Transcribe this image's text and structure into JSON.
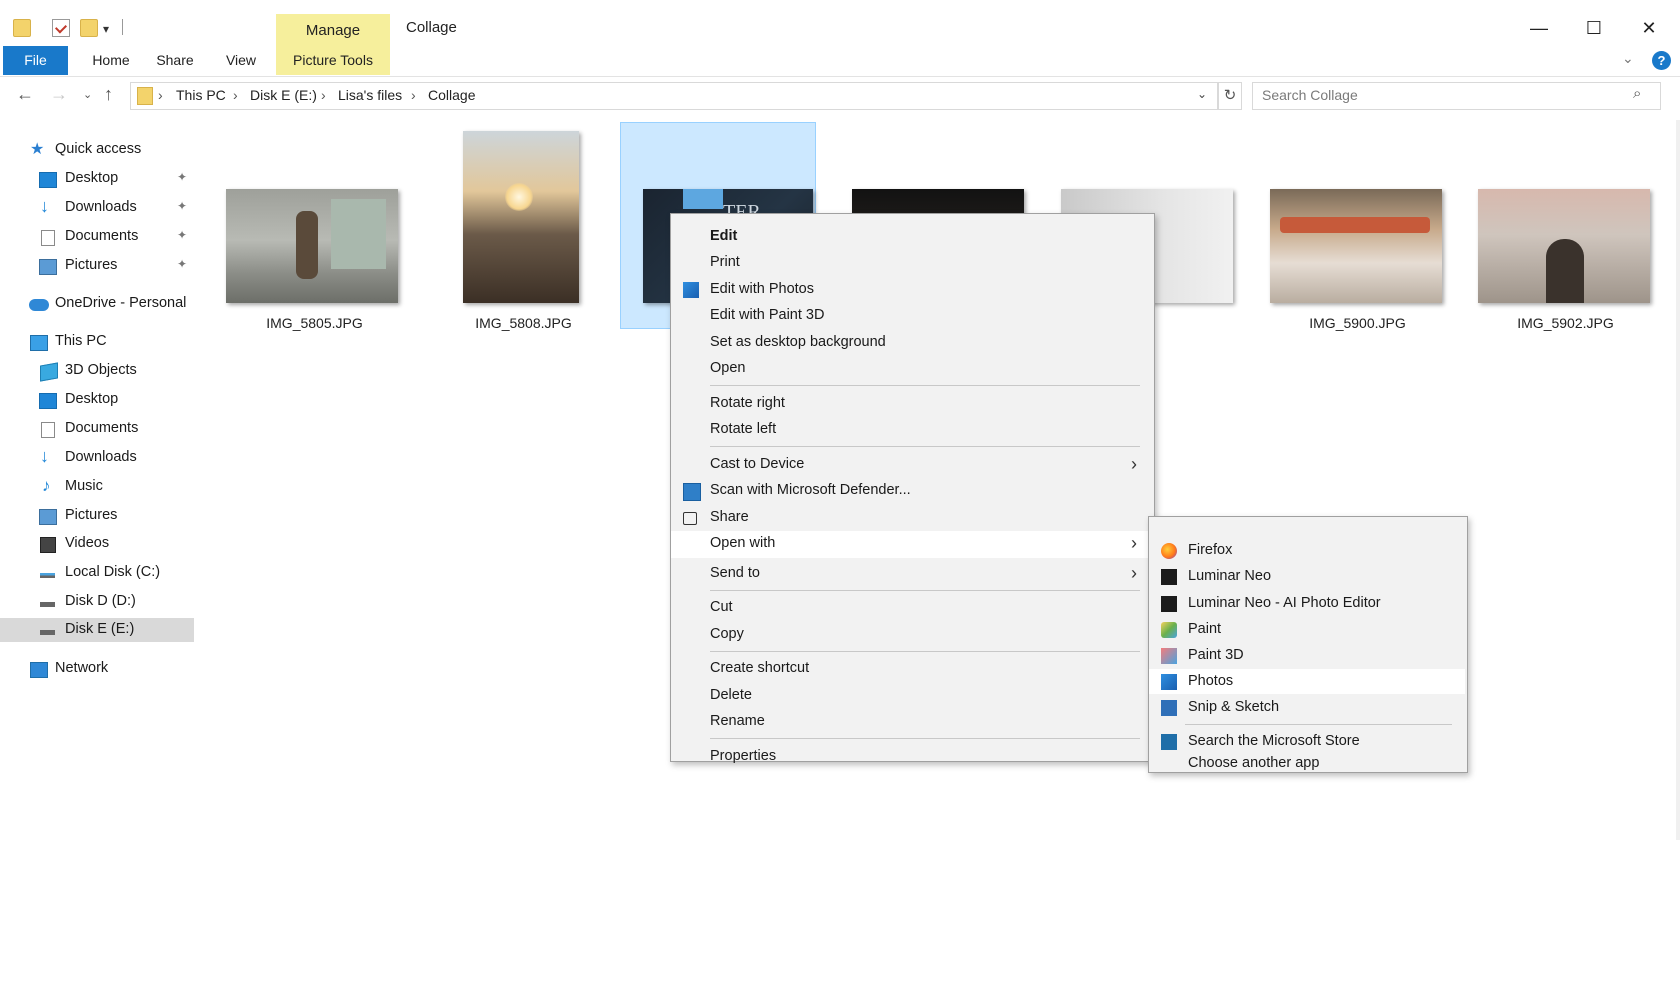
{
  "window": {
    "title": "Collage",
    "manage_label": "Manage",
    "qa_dropdown": "▾",
    "minimize": "—",
    "maximize": "☐",
    "close": "✕"
  },
  "ribbon": {
    "tabs": [
      "File",
      "Home",
      "Share",
      "View",
      "Picture Tools"
    ],
    "expand": "⌄",
    "help": "?"
  },
  "address": {
    "back": "←",
    "forward": "→",
    "recent": "⌄",
    "up": "↑",
    "breadcrumb": [
      "This PC",
      "Disk E (E:)",
      "Lisa's files",
      "Collage"
    ],
    "separator": "›",
    "dropdown": "⌄",
    "refresh": "↻",
    "search_placeholder": "Search Collage",
    "search_icon": "⌕"
  },
  "nav": {
    "pin_glyph": "✦",
    "items": [
      {
        "label": "Quick access",
        "icon": "star-icon"
      },
      {
        "label": "Desktop",
        "icon": "desktop-icon",
        "pinned": true
      },
      {
        "label": "Downloads",
        "icon": "download-icon",
        "pinned": true
      },
      {
        "label": "Documents",
        "icon": "documents-icon",
        "pinned": true
      },
      {
        "label": "Pictures",
        "icon": "pictures-icon",
        "pinned": true
      },
      {
        "label": "OneDrive - Personal",
        "icon": "cloud-icon"
      },
      {
        "label": "This PC",
        "icon": "pc-icon"
      },
      {
        "label": "3D Objects",
        "icon": "3d-objects-icon"
      },
      {
        "label": "Desktop",
        "icon": "desktop-icon"
      },
      {
        "label": "Documents",
        "icon": "documents-icon"
      },
      {
        "label": "Downloads",
        "icon": "download-icon"
      },
      {
        "label": "Music",
        "icon": "music-icon"
      },
      {
        "label": "Pictures",
        "icon": "pictures-icon"
      },
      {
        "label": "Videos",
        "icon": "videos-icon"
      },
      {
        "label": "Local Disk (C:)",
        "icon": "disk-icon"
      },
      {
        "label": "Disk D (D:)",
        "icon": "disk-icon"
      },
      {
        "label": "Disk E (E:)",
        "icon": "disk-icon",
        "selected": true
      },
      {
        "label": "Network",
        "icon": "network-icon"
      }
    ]
  },
  "files": [
    {
      "name": "IMG_5805.JPG"
    },
    {
      "name": "IMG_5808.JPG"
    },
    {
      "name": "",
      "selected": true,
      "overlay_text": "TER"
    },
    {
      "name": ""
    },
    {
      "name": "PG"
    },
    {
      "name": "IMG_5900.JPG"
    },
    {
      "name": "IMG_5902.JPG"
    }
  ],
  "context_menu": {
    "submenu_arrow": "›",
    "items": [
      {
        "label": "Edit",
        "bold": true
      },
      {
        "label": "Print"
      },
      {
        "label": "Edit with Photos",
        "icon": "photos-icon"
      },
      {
        "label": "Edit with Paint 3D"
      },
      {
        "label": "Set as desktop background"
      },
      {
        "label": "Open"
      },
      {
        "label": "Rotate right"
      },
      {
        "label": "Rotate left"
      },
      {
        "label": "Cast to Device",
        "submenu": true
      },
      {
        "label": "Scan with Microsoft Defender...",
        "icon": "defender-icon"
      },
      {
        "label": "Share",
        "icon": "share-icon"
      },
      {
        "label": "Open with",
        "submenu": true,
        "hover": true
      },
      {
        "label": "Send to",
        "submenu": true
      },
      {
        "label": "Cut"
      },
      {
        "label": "Copy"
      },
      {
        "label": "Create shortcut"
      },
      {
        "label": "Delete"
      },
      {
        "label": "Rename"
      },
      {
        "label": "Properties"
      }
    ]
  },
  "open_with": {
    "items": [
      {
        "label": "Firefox",
        "icon": "firefox-icon"
      },
      {
        "label": "Luminar Neo",
        "icon": "luminar-neo-icon"
      },
      {
        "label": "Luminar Neo - AI Photo Editor",
        "icon": "luminar-neo-ai-icon"
      },
      {
        "label": "Paint",
        "icon": "paint-icon"
      },
      {
        "label": "Paint 3D",
        "icon": "paint-3d-icon"
      },
      {
        "label": "Photos",
        "icon": "photos-icon",
        "hover": true
      },
      {
        "label": "Snip & Sketch",
        "icon": "snip-sketch-icon"
      },
      {
        "label": "Search the Microsoft Store",
        "icon": "store-icon"
      },
      {
        "label": "Choose another app"
      }
    ]
  },
  "colors": {
    "accent": "#1979ca",
    "picture_tools": "#f6ef9c",
    "selection": "#cce8ff",
    "menu_bg": "#f2f2f2"
  }
}
